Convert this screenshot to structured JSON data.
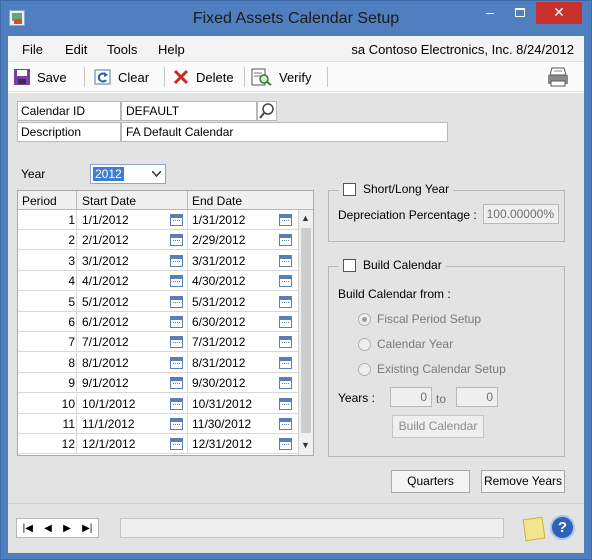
{
  "window": {
    "title": "Fixed Assets Calendar Setup",
    "min_glyph": "–",
    "close_glyph": "✕"
  },
  "menu": {
    "items": [
      "File",
      "Edit",
      "Tools",
      "Help"
    ],
    "company_info": "sa  Contoso Electronics, Inc.  8/24/2012"
  },
  "toolbar": {
    "save": "Save",
    "clear": "Clear",
    "delete": "Delete",
    "verify": "Verify"
  },
  "form": {
    "calendar_id_label": "Calendar ID",
    "calendar_id_value": "DEFAULT",
    "description_label": "Description",
    "description_value": "FA Default Calendar",
    "year_label": "Year",
    "year_value": "2012"
  },
  "grid": {
    "columns": [
      "Period",
      "Start Date",
      "End Date"
    ],
    "rows": [
      {
        "period": "1",
        "start": "1/1/2012",
        "end": "1/31/2012"
      },
      {
        "period": "2",
        "start": "2/1/2012",
        "end": "2/29/2012"
      },
      {
        "period": "3",
        "start": "3/1/2012",
        "end": "3/31/2012"
      },
      {
        "period": "4",
        "start": "4/1/2012",
        "end": "4/30/2012"
      },
      {
        "period": "5",
        "start": "5/1/2012",
        "end": "5/31/2012"
      },
      {
        "period": "6",
        "start": "6/1/2012",
        "end": "6/30/2012"
      },
      {
        "period": "7",
        "start": "7/1/2012",
        "end": "7/31/2012"
      },
      {
        "period": "8",
        "start": "8/1/2012",
        "end": "8/31/2012"
      },
      {
        "period": "9",
        "start": "9/1/2012",
        "end": "9/30/2012"
      },
      {
        "period": "10",
        "start": "10/1/2012",
        "end": "10/31/2012"
      },
      {
        "period": "11",
        "start": "11/1/2012",
        "end": "11/30/2012"
      },
      {
        "period": "12",
        "start": "12/1/2012",
        "end": "12/31/2012"
      }
    ]
  },
  "short_long_year": {
    "label": "Short/Long Year",
    "checked": false,
    "depreciation_label": "Depreciation Percentage :",
    "depreciation_value": "100.00000%"
  },
  "build_calendar": {
    "label": "Build Calendar",
    "checked": false,
    "from_label": "Build Calendar from :",
    "options": [
      "Fiscal Period Setup",
      "Calendar Year",
      "Existing Calendar Setup"
    ],
    "selected_option": "Fiscal Period Setup",
    "years_label": "Years :",
    "years_from": "0",
    "to_label": "to",
    "years_to": "0",
    "button": "Build Calendar"
  },
  "buttons": {
    "quarters": "Quarters",
    "remove_years": "Remove Years"
  },
  "colors": {
    "title_bar": "#4f7fbf",
    "close_button": "#c7302b",
    "form_background": "#e3e3e3"
  }
}
